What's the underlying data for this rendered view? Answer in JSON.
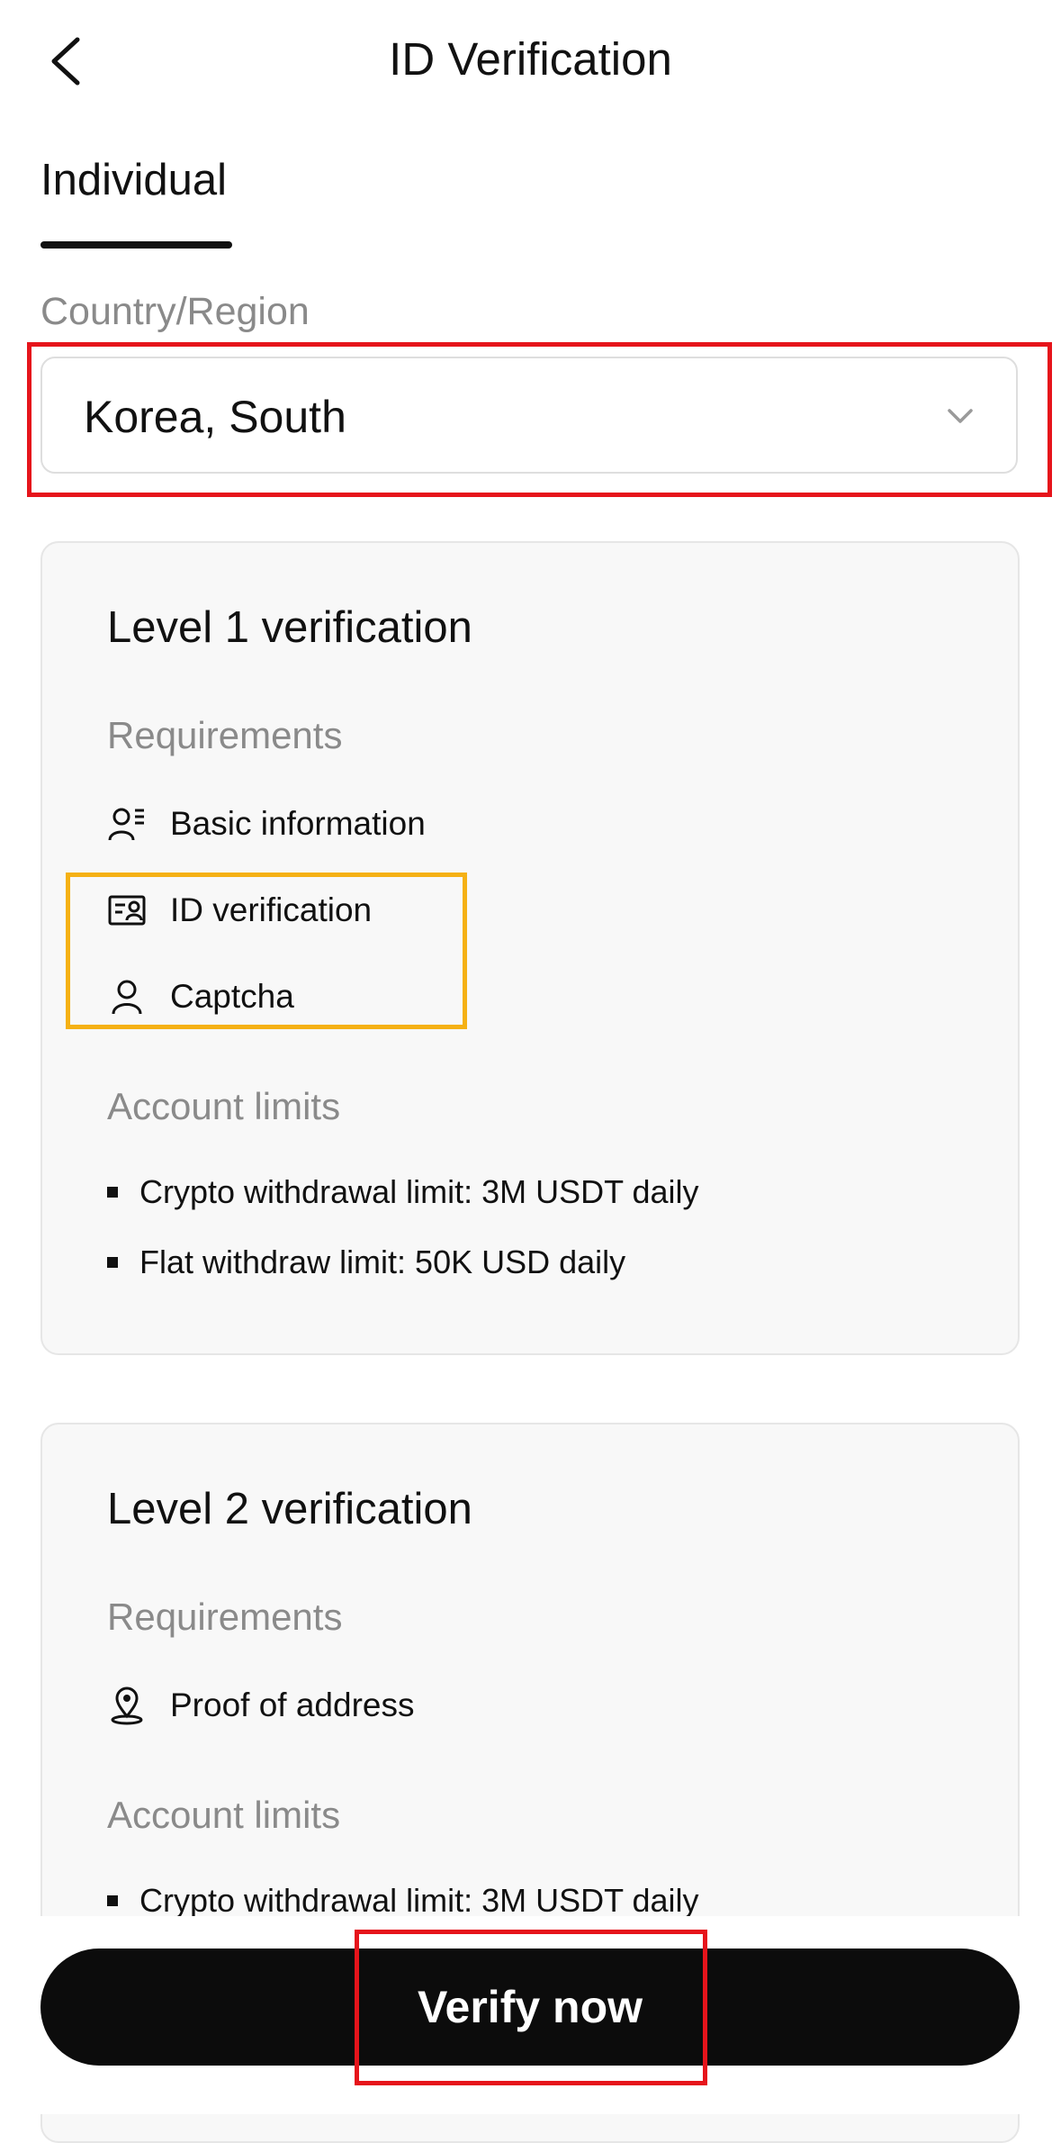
{
  "header": {
    "title": "ID Verification"
  },
  "tabs": [
    {
      "label": "Individual",
      "active": true
    }
  ],
  "country": {
    "label": "Country/Region",
    "value": "Korea, South"
  },
  "levels": [
    {
      "title": "Level 1 verification",
      "requirements_label": "Requirements",
      "requirements": [
        {
          "icon": "basic-info-icon",
          "label": "Basic information"
        },
        {
          "icon": "id-card-icon",
          "label": "ID verification"
        },
        {
          "icon": "person-icon",
          "label": "Captcha"
        }
      ],
      "limits_label": "Account limits",
      "limits": [
        "Crypto withdrawal limit: 3M USDT daily",
        "Flat withdraw limit: 50K USD daily"
      ]
    },
    {
      "title": "Level 2 verification",
      "requirements_label": "Requirements",
      "requirements": [
        {
          "icon": "location-pin-icon",
          "label": "Proof of address"
        }
      ],
      "limits_label": "Account limits",
      "limits": [
        "Crypto withdrawal limit: 3M USDT daily"
      ]
    }
  ],
  "actions": {
    "verify_label": "Verify now"
  },
  "colors": {
    "annotation_red": "#e6141b",
    "annotation_yellow": "#f5b114",
    "button_bg": "#0c0c0c"
  }
}
